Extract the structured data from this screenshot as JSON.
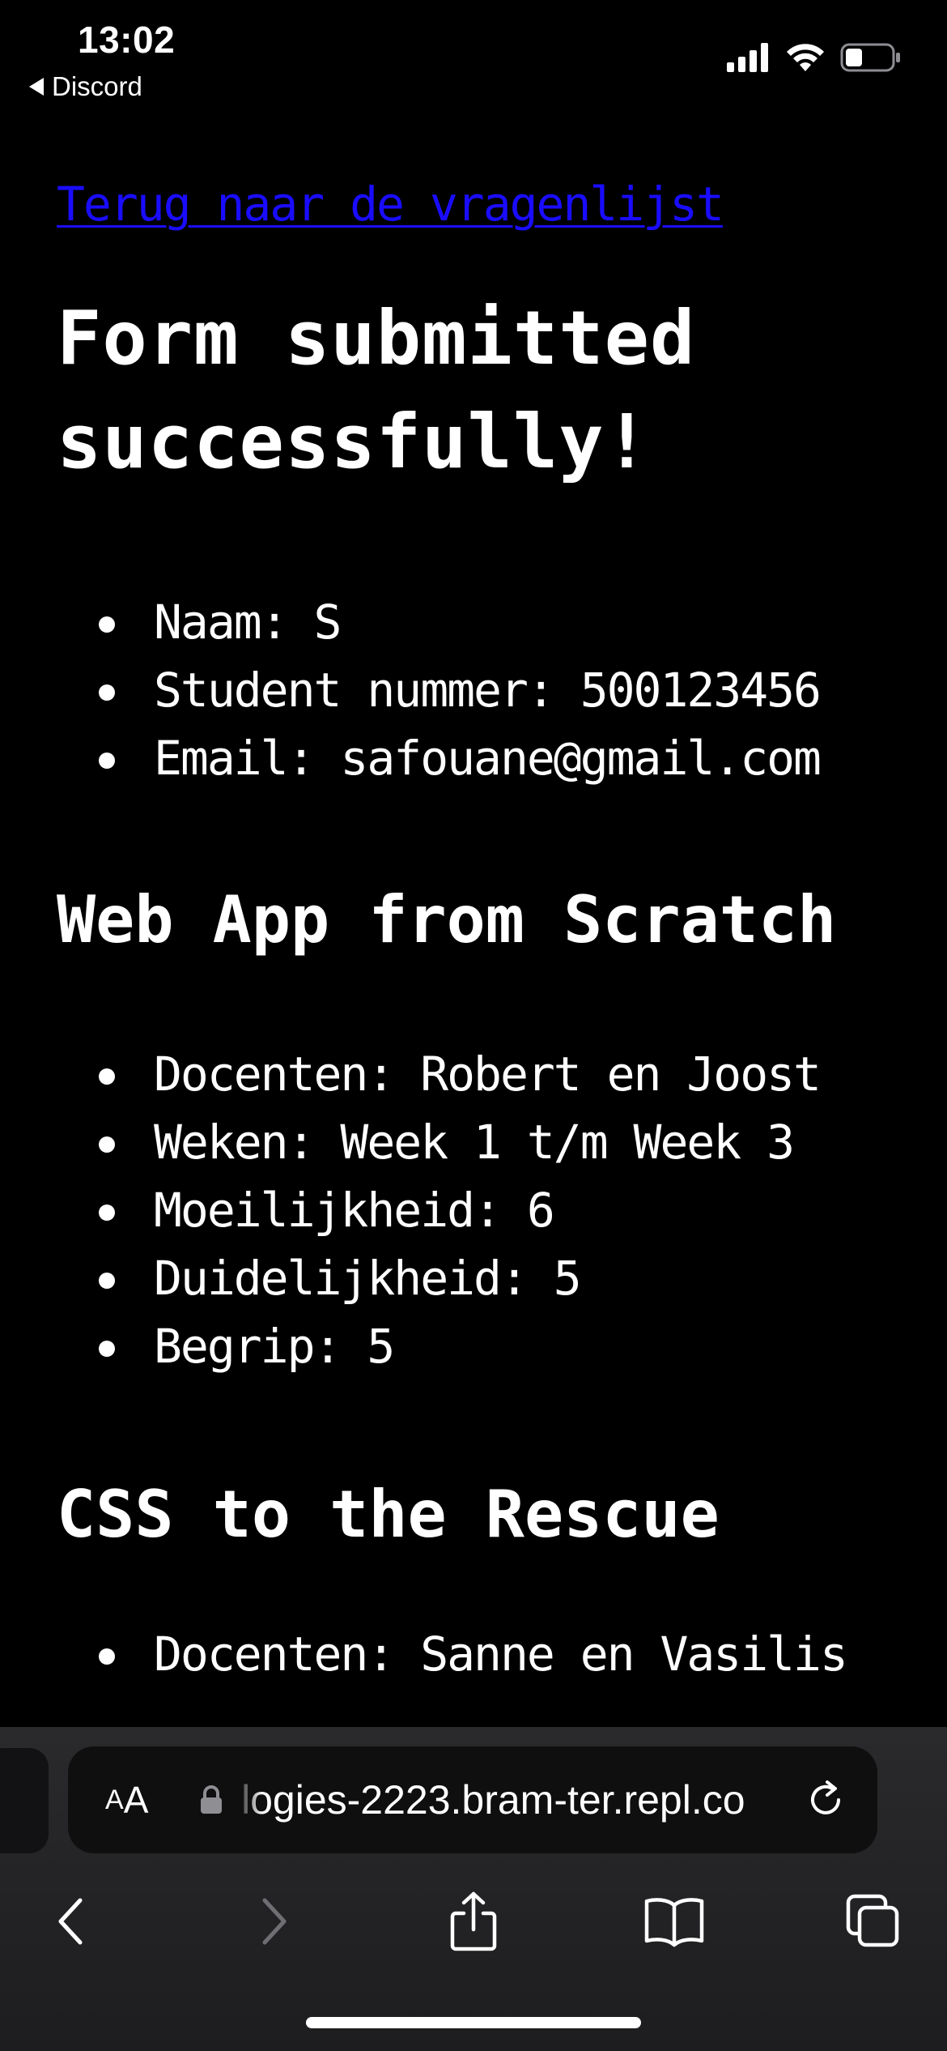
{
  "status_bar": {
    "time": "13:02",
    "back_app": "Discord"
  },
  "page": {
    "back_link": "Terug naar de vragenlijst",
    "title": "Form submitted successfully!",
    "personal": [
      "Naam: S",
      "Student nummer: 500123456",
      "Email: safouane@gmail.com"
    ],
    "courses": [
      {
        "title": "Web App from Scratch",
        "items": [
          "Docenten: Robert en Joost",
          "Weken: Week 1 t/m Week 3",
          "Moeilijkheid: 6",
          "Duidelijkheid: 5",
          "Begrip: 5"
        ]
      },
      {
        "title": "CSS to the Rescue",
        "items": [
          "Docenten: Sanne en Vasilis"
        ]
      }
    ]
  },
  "browser": {
    "text_size_small": "A",
    "text_size_big": "A",
    "url": "logies-2223.bram-ter.repl.co"
  },
  "icons": {
    "signal": "cellular-signal-icon",
    "wifi": "wifi-icon",
    "battery": "battery-icon",
    "lock": "lock-icon",
    "reload": "reload-icon",
    "back": "chevron-left-icon",
    "forward": "chevron-right-icon",
    "share": "share-icon",
    "bookmarks": "book-icon",
    "tabs": "tabs-icon"
  },
  "colors": {
    "background": "#000000",
    "link": "#1a0dff",
    "text": "#ffffff",
    "toolbar": "#2a2a2c"
  }
}
